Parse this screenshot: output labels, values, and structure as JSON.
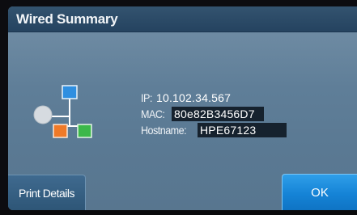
{
  "window": {
    "title": "Wired Summary"
  },
  "network": {
    "icon": "network-topology-icon",
    "ip_label": "IP:",
    "ip_value": "10.102.34.567",
    "mac_label": "MAC:",
    "mac_value": "80e82B3456D7",
    "hostname_label": "Hostname:",
    "hostname_value": "HPE67123"
  },
  "buttons": {
    "print_details_label": "Print Details",
    "ok_label": "OK"
  },
  "colors": {
    "title_bar": "#254360",
    "panel": "#5f7e98",
    "print_button": "#2e5677",
    "ok_button": "#1583d6",
    "icon_blue": "#2f8fe0",
    "icon_orange": "#f07a28",
    "icon_green": "#3cb84a",
    "icon_node": "#d8dde2"
  }
}
